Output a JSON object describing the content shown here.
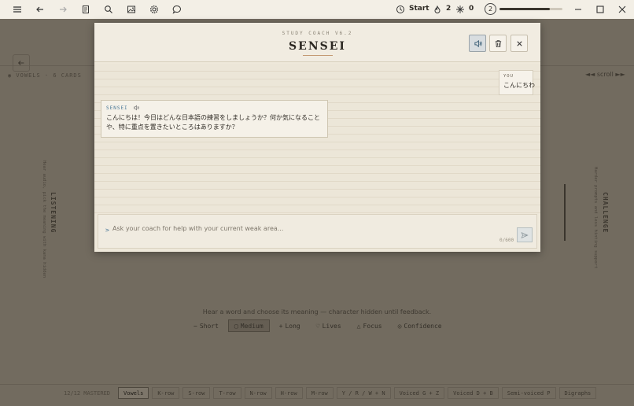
{
  "topbar": {
    "start_label": "Start",
    "streak_count": "2",
    "gems_count": "0",
    "level": "2",
    "progress_fraction": 0.8
  },
  "background": {
    "breadcrumb": "◉ VOWELS · 6 CARDS",
    "scroll_label": "◄◄ scroll ►►",
    "left_panel_title": "LISTENING",
    "left_panel_desc": "Hear audio, pick the meaning with kana hidden",
    "right_panel_title": "CHALLENGE",
    "right_panel_desc": "Harder prompts and less hinting support",
    "caption": "Hear a word and choose its meaning — character hidden until feedback.",
    "options": [
      {
        "icon": "−",
        "label": "Short",
        "selected": false
      },
      {
        "icon": "▢",
        "label": "Medium",
        "selected": true
      },
      {
        "icon": "+",
        "label": "Long",
        "selected": false
      },
      {
        "icon": "♡",
        "label": "Lives",
        "selected": false
      },
      {
        "icon": "△",
        "label": "Focus",
        "selected": false
      },
      {
        "icon": "◎",
        "label": "Confidence",
        "selected": false
      }
    ],
    "footer_progress": "12/12 MASTERED",
    "footer_tabs": [
      "Vowels",
      "K-row",
      "S-row",
      "T-row",
      "N-row",
      "H-row",
      "M-row",
      "Y / R / W + N",
      "Voiced G + Z",
      "Voiced D + B",
      "Semi-voiced P",
      "Digraphs"
    ]
  },
  "modal": {
    "subtitle": "STUDY COACH V6.2",
    "title": "SENSEI",
    "you_label": "YOU",
    "you_message": "こんにちわ",
    "sensei_label": "SENSEI",
    "sensei_message": "こんにちは！今日はどんな日本語の練習をしましょうか？何か気になることや、特に重点を置きたいところはありますか？",
    "input_placeholder": "Ask your coach for help with your current weak area...",
    "input_value": "",
    "char_counter": "0/600"
  }
}
